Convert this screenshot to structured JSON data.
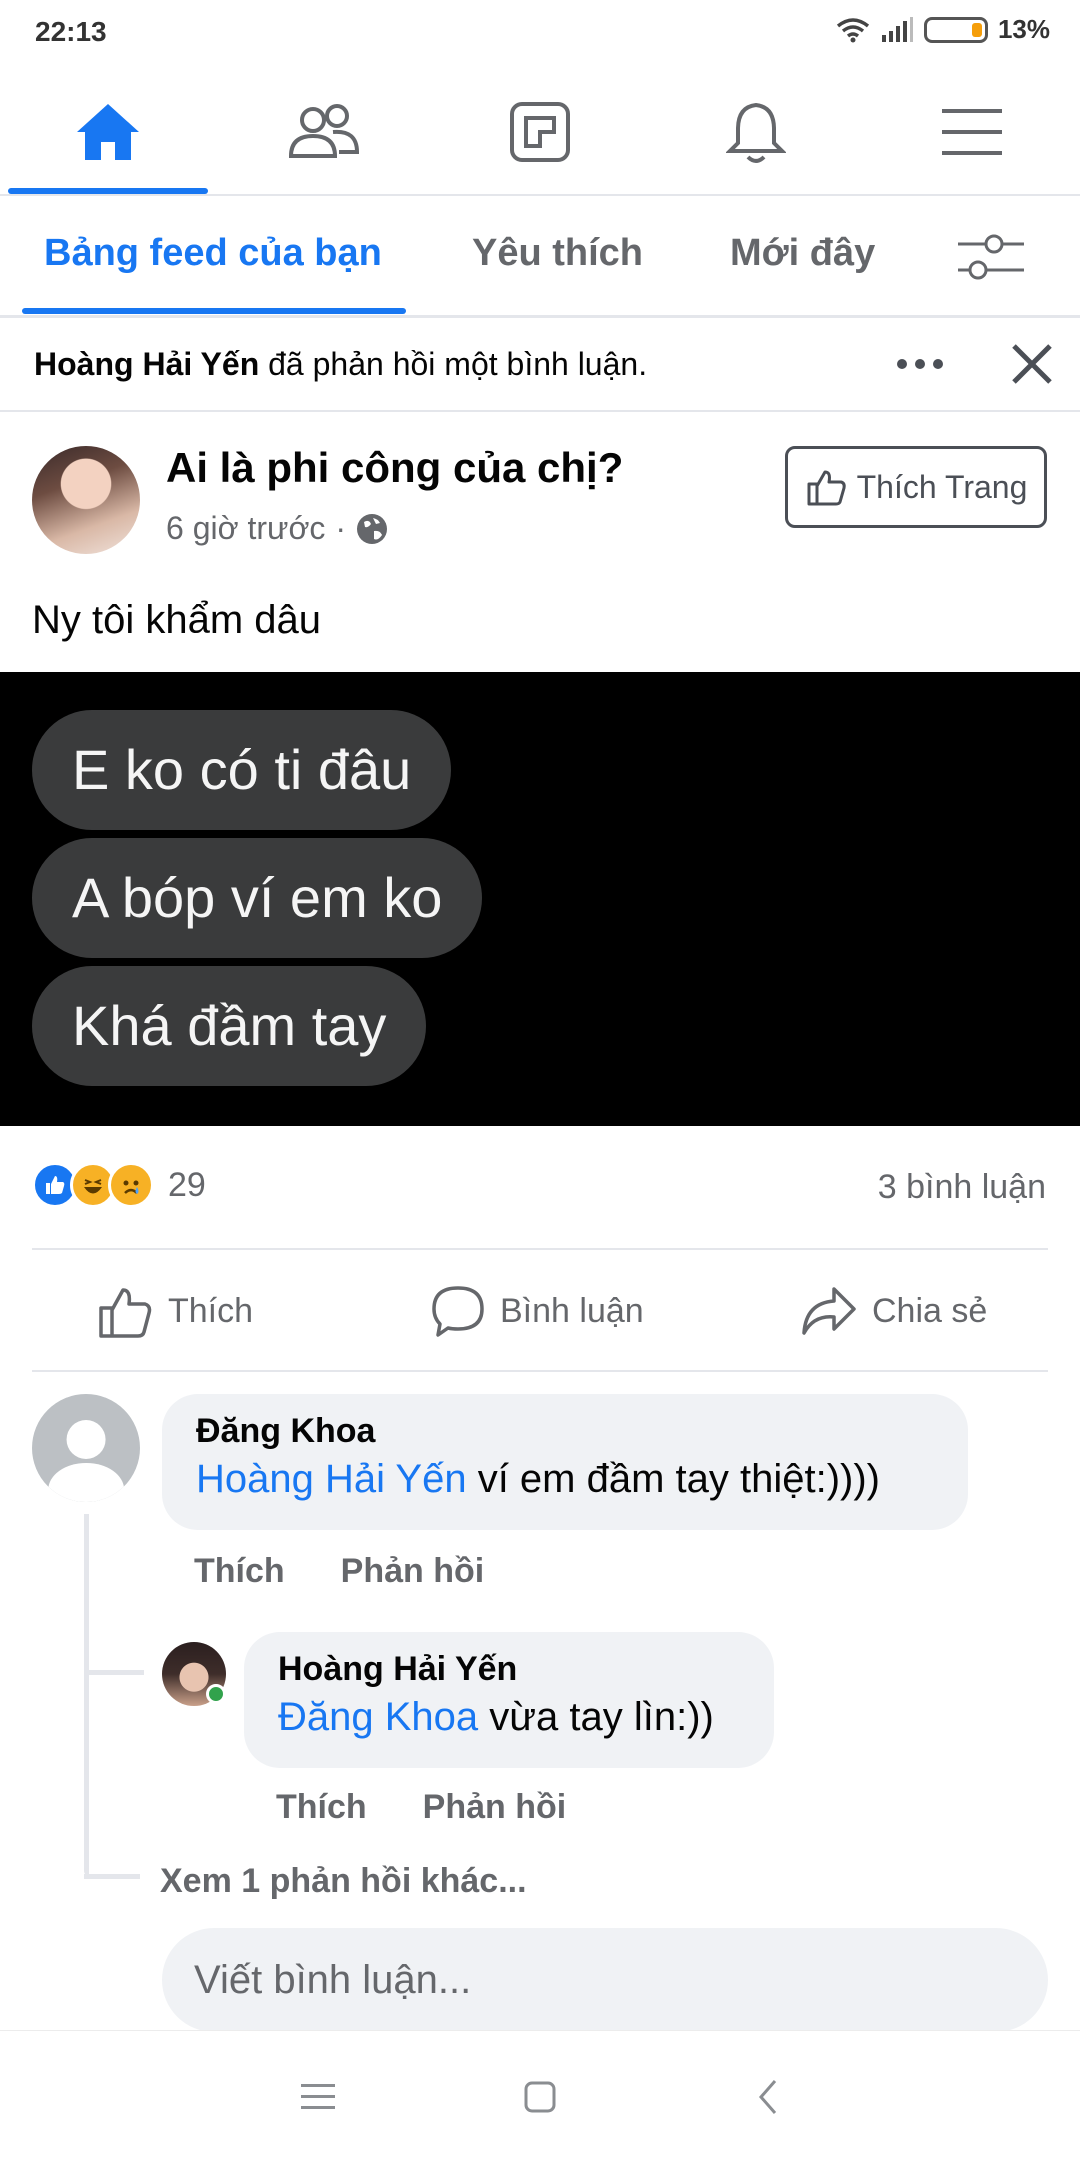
{
  "status_bar": {
    "time": "22:13",
    "battery": "13%"
  },
  "top_nav": {
    "items": [
      "home-icon",
      "friends-icon",
      "pages-icon",
      "notifications-icon",
      "menu-icon"
    ],
    "active_index": 0
  },
  "feed_tabs": {
    "tabs": [
      "Bảng feed của bạn",
      "Yêu thích",
      "Mới đây"
    ],
    "active_index": 0
  },
  "notification": {
    "actor": "Hoàng Hải Yến",
    "text": " đã phản hồi một bình luận."
  },
  "post": {
    "page_name": "Ai là phi công của chị?",
    "time": "6 giờ trước",
    "separator": "·",
    "like_page_label": "Thích Trang",
    "caption": "Ny tôi khẩm dâu",
    "image_messages": [
      "E ko có ti đâu",
      "A bóp ví em ko",
      "Khá đầm tay"
    ],
    "reaction_count": "29",
    "comment_count": "3 bình luận",
    "actions": {
      "like": "Thích",
      "comment": "Bình luận",
      "share": "Chia sẻ"
    }
  },
  "comments": [
    {
      "author": "Đăng Khoa",
      "mention": "Hoàng Hải Yến",
      "text": " ví em đầm tay thiệt:))))",
      "like_label": "Thích",
      "reply_label": "Phản hồi"
    }
  ],
  "reply": {
    "author": "Hoàng Hải Yến",
    "mention": "Đăng Khoa",
    "text": " vừa tay lìn:))",
    "like_label": "Thích",
    "reply_label": "Phản hồi"
  },
  "more_replies": "Xem 1 phản hồi khác...",
  "write_comment_placeholder": "Viết bình luận...",
  "colors": {
    "accent": "#1877f2",
    "muted": "#65676b",
    "bubble": "#f0f2f5"
  }
}
